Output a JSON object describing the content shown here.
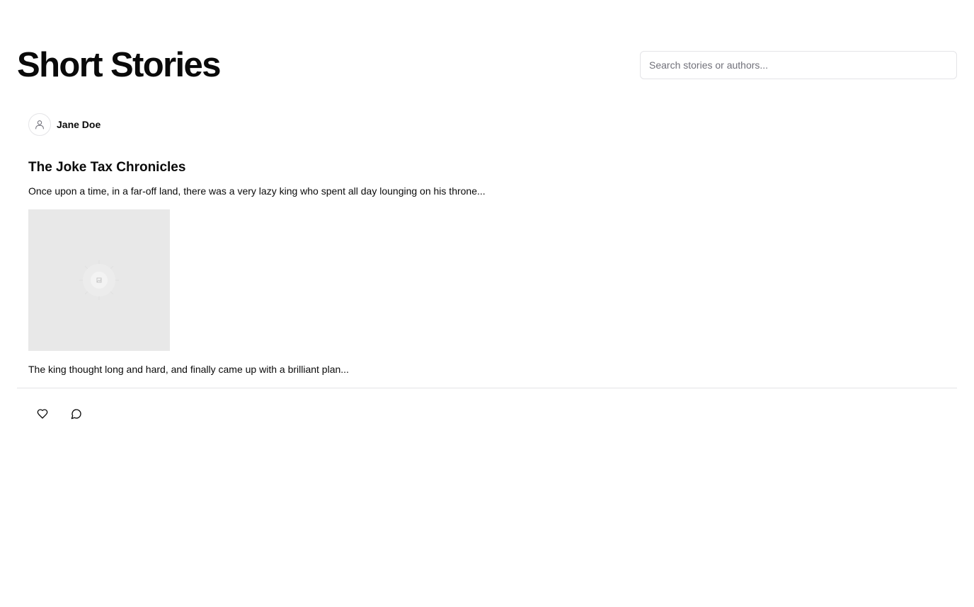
{
  "header": {
    "title": "Short Stories",
    "search_placeholder": "Search stories or authors..."
  },
  "post": {
    "author": {
      "name": "Jane Doe",
      "avatar_icon": "user-icon"
    },
    "title": "The Joke Tax Chronicles",
    "paragraphs": [
      "Once upon a time, in a far-off land, there was a very lazy king who spent all day lounging on his throne...",
      "The king thought long and hard, and finally came up with a brilliant plan..."
    ],
    "image_icon": "image-placeholder-icon",
    "actions": {
      "like_icon": "heart-icon",
      "comment_icon": "comment-icon"
    }
  },
  "colors": {
    "text": "#0a0a0a",
    "border": "#e4e4e7",
    "placeholder_text": "#71717a",
    "image_background": "#e8e8e8"
  }
}
